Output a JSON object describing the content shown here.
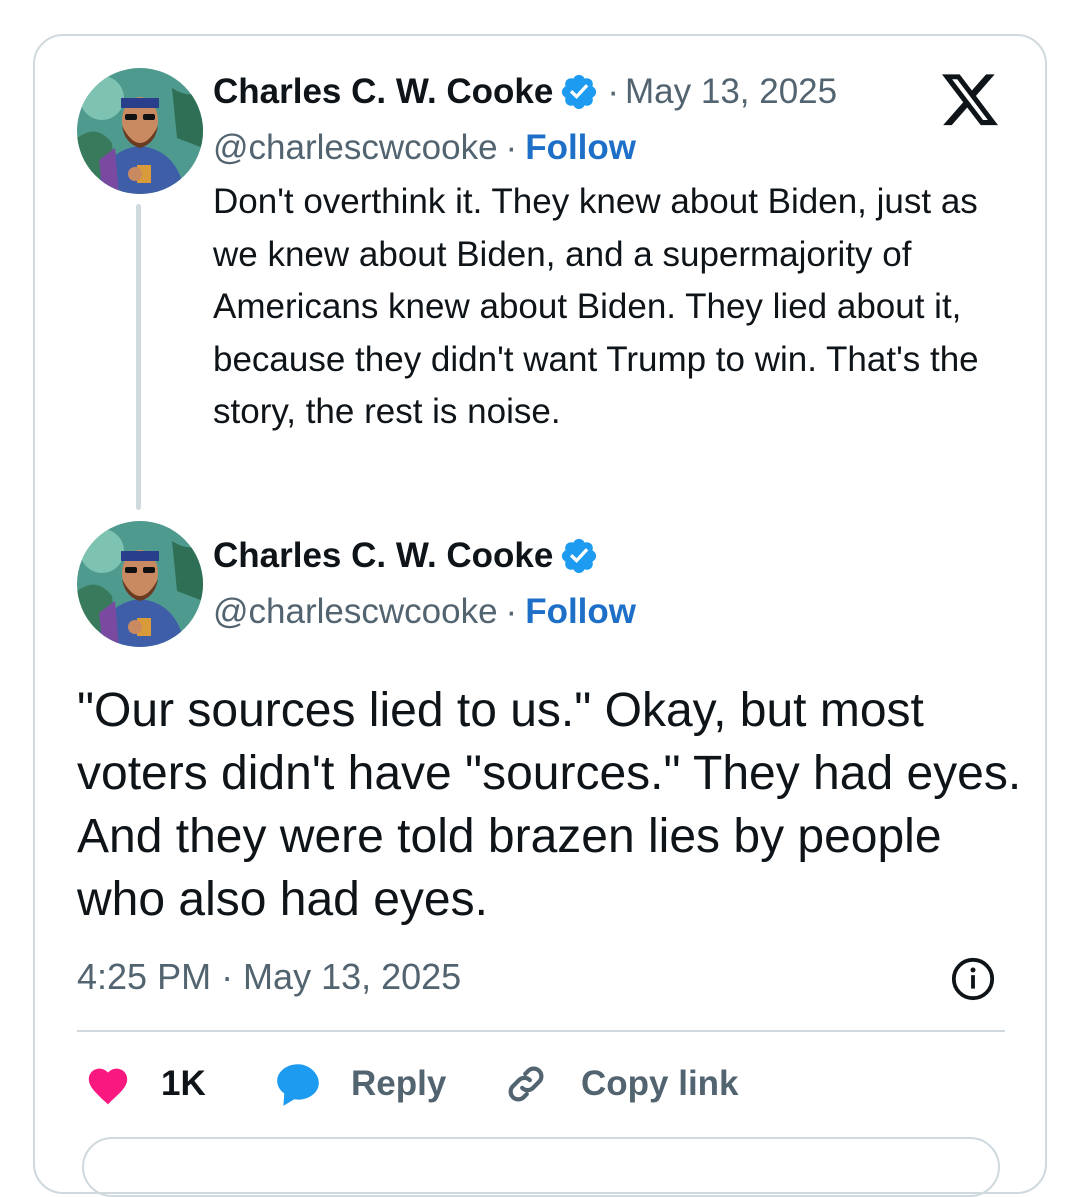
{
  "reply_tweet": {
    "author_name": "Charles C. W. Cooke",
    "separator": "·",
    "date": "May 13, 2025",
    "handle": "@charlescwcooke",
    "follow_label": "Follow",
    "text": "Don't overthink it. They knew about Biden, just as we knew about Biden, and a supermajority of Americans knew about Biden. They lied about it, because they didn't want Trump to win. That's the story, the rest is noise."
  },
  "main_tweet": {
    "author_name": "Charles C. W. Cooke",
    "handle": "@charlescwcooke",
    "follow_label": "Follow",
    "text": "\"Our sources lied to us.\" Okay, but most voters didn't have \"sources.\" They had eyes. And they were told brazen lies by people who also had eyes.",
    "timestamp": "4:25 PM · May 13, 2025"
  },
  "actions": {
    "like_count": "1K",
    "reply_label": "Reply",
    "copy_link_label": "Copy link"
  },
  "icons": {
    "platform_logo": "x-logo",
    "verified": "verified-badge-icon",
    "info": "info-icon",
    "like": "heart-icon",
    "reply": "speech-bubble-icon",
    "copy_link": "link-icon"
  },
  "colors": {
    "verified_blue": "#1d9bf0",
    "follow_blue": "#1d6fc8",
    "heart_pink": "#f91880",
    "reply_blue": "#1d9bf0",
    "secondary_text": "#536471",
    "border": "#cfd9de"
  }
}
